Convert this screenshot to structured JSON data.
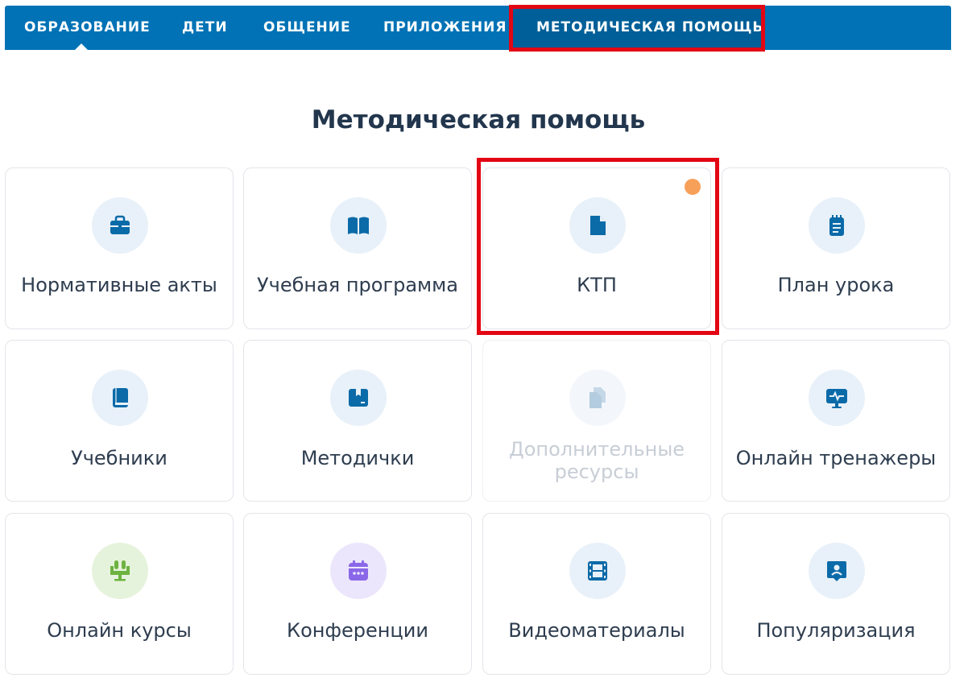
{
  "nav": {
    "items": [
      {
        "label": "ОБРАЗОВАНИЕ"
      },
      {
        "label": "ДЕТИ"
      },
      {
        "label": "ОБЩЕНИЕ"
      },
      {
        "label": "ПРИЛОЖЕНИЯ"
      },
      {
        "label": "МЕТОДИЧЕСКАЯ ПОМОЩЬ"
      }
    ],
    "active": "МЕТОДИЧЕСКАЯ ПОМОЩЬ"
  },
  "page": {
    "title": "Методическая помощь"
  },
  "cards": [
    {
      "label": "Нормативные акты",
      "icon": "briefcase-icon"
    },
    {
      "label": "Учебная программа",
      "icon": "open-book-icon"
    },
    {
      "label": "КТП",
      "icon": "document-icon",
      "badge": "new-indicator"
    },
    {
      "label": "План урока",
      "icon": "notepad-icon"
    },
    {
      "label": "Учебники",
      "icon": "book-icon"
    },
    {
      "label": "Методички",
      "icon": "box-icon"
    },
    {
      "label_line1": "Дополнительные",
      "label_line2": "ресурсы",
      "icon": "copy-documents-icon",
      "disabled": true
    },
    {
      "label": "Онлайн тренажеры",
      "icon": "monitor-pulse-icon"
    },
    {
      "label": "Онлайн курсы",
      "icon": "lectern-icon"
    },
    {
      "label": "Конференции",
      "icon": "calendar-icon"
    },
    {
      "label": "Видеоматериалы",
      "icon": "film-icon"
    },
    {
      "label": "Популяризация",
      "icon": "location-person-icon"
    }
  ],
  "colors": {
    "nav_bg": "#0072b5",
    "nav_active_bg": "#005f98",
    "highlight": "#e30613",
    "icon_blue": "#0b6aa8",
    "icon_green": "#6db33f",
    "icon_purple": "#8a67e8",
    "badge": "#f7a05a"
  }
}
